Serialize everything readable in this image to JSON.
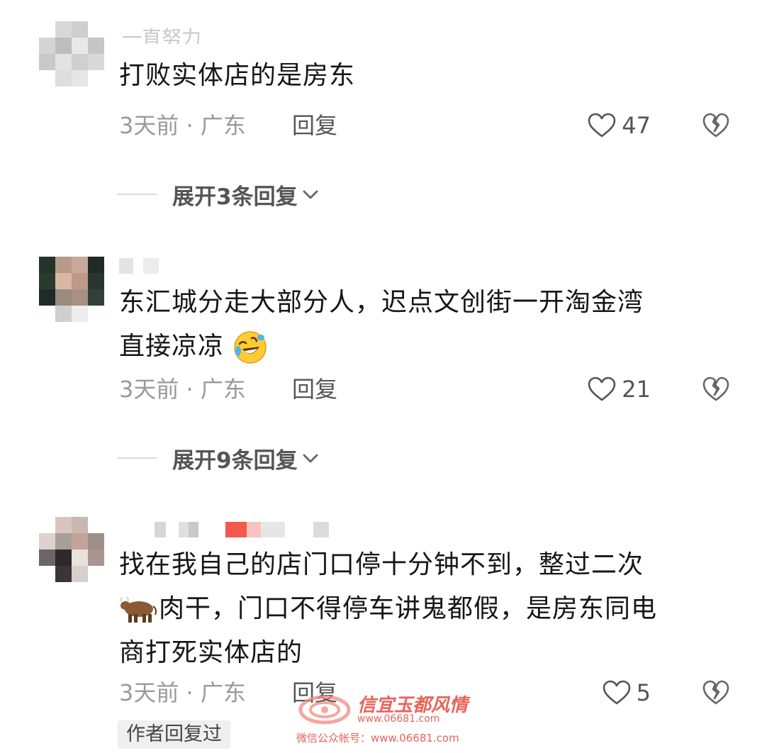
{
  "comments": [
    {
      "username": "一直努力",
      "text_lines": [
        "打败实体店的是房东"
      ],
      "meta": "3天前 · 广东",
      "reply_label": "回复",
      "likes": "47",
      "expand_label": "展开3条回复"
    },
    {
      "text_lines": [
        "东汇城分走大部分人，迟点文创街一开淘金湾",
        "直接凉凉"
      ],
      "emoji": "rolling-on-floor-laughing",
      "meta": "3天前 · 广东",
      "reply_label": "回复",
      "likes": "21",
      "expand_label": "展开9条回复"
    },
    {
      "text_lines": [
        "找在我自己的店门口停十分钟不到，整过二次",
        "肉干，门口不得停车讲鬼都假，是房东同电",
        "商打死实体店的"
      ],
      "emoji": "ox",
      "meta": "3天前 · 广东",
      "reply_label": "回复",
      "likes": "5",
      "author_badge": "作者回复过"
    }
  ],
  "watermark": {
    "title": "信宜玉都风情",
    "url": "www.06681.com",
    "subtitle": "微信公众帐号：www.06681.com"
  },
  "icons": {
    "like": "heart-outline-icon",
    "dislike": "broken-heart-icon",
    "expand": "chevron-down-icon"
  },
  "colors": {
    "text": "#161616",
    "meta": "#9a9a9a",
    "watermark": "#e8645a"
  }
}
